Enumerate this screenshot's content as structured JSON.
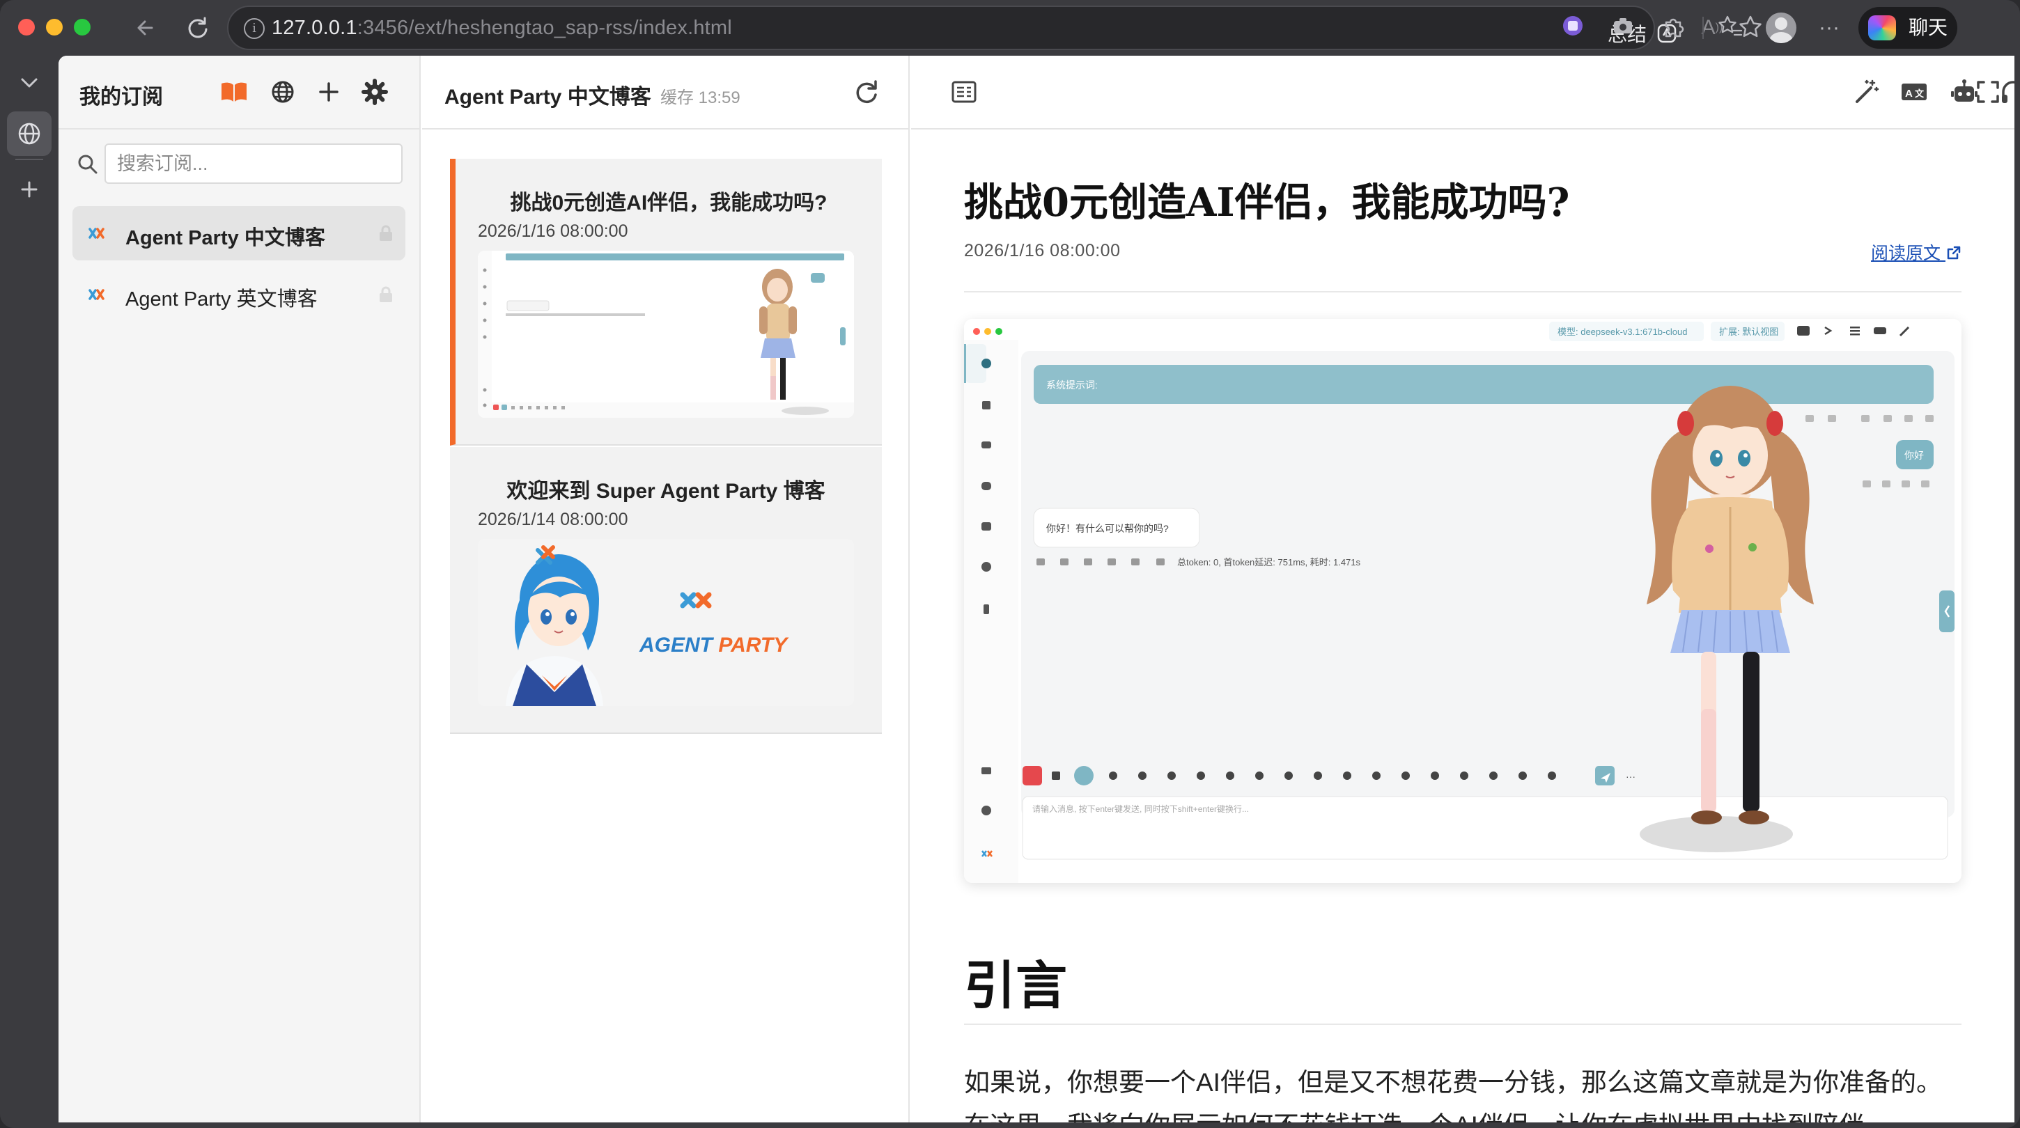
{
  "browser": {
    "url_host": "127.0.0.1",
    "url_rest": ":3456/ext/heshengtao_sap-rss/index.html",
    "summary_label": "总结",
    "chat_label": "聊天"
  },
  "sidebar": {
    "title": "我的订阅",
    "search_placeholder": "搜索订阅...",
    "feeds": [
      {
        "label": "Agent Party 中文博客",
        "active": true
      },
      {
        "label": "Agent Party 英文博客",
        "active": false
      }
    ]
  },
  "list": {
    "title": "Agent Party 中文博客",
    "cache_status": "缓存 13:59",
    "articles": [
      {
        "title": "挑战0元创造AI伴侣，我能成功吗?",
        "date": "2026/1/16 08:00:00",
        "active": true
      },
      {
        "title": "欢迎来到 Super Agent Party 博客",
        "date": "2026/1/14 08:00:00",
        "active": false,
        "thumb_text": "AGENT PARTY"
      }
    ]
  },
  "article": {
    "title": "挑战0元创造AI伴侣，我能成功吗?",
    "date": "2026/1/16 08:00:00",
    "read_original": "阅读原文",
    "heading": "引言",
    "paragraph": "如果说，你想要一个AI伴侣，但是又不想花费一分钱，那么这篇文章就是为你准备的。在这里，我将向你展示如何不花钱打造一个AI伴侣，让你在虚拟世界中找到陪伴。",
    "image": {
      "model_chip": "模型: deepseek-v3.1:671b-cloud",
      "ext_chip": "扩展: 默认视图",
      "system_prompt": "系统提示词:",
      "user_msg": "你好",
      "assistant_msg": "你好！有什么可以帮你的吗?",
      "stats": "总token: 0, 首token延迟: 751ms, 耗时: 1.471s",
      "input_placeholder": "请输入消息, 按下enter键发送, 同时按下shift+enter键换行..."
    }
  },
  "colors": {
    "accent": "#f26a2a",
    "link": "#1a4fb5",
    "teal": "#7fb6c4"
  }
}
